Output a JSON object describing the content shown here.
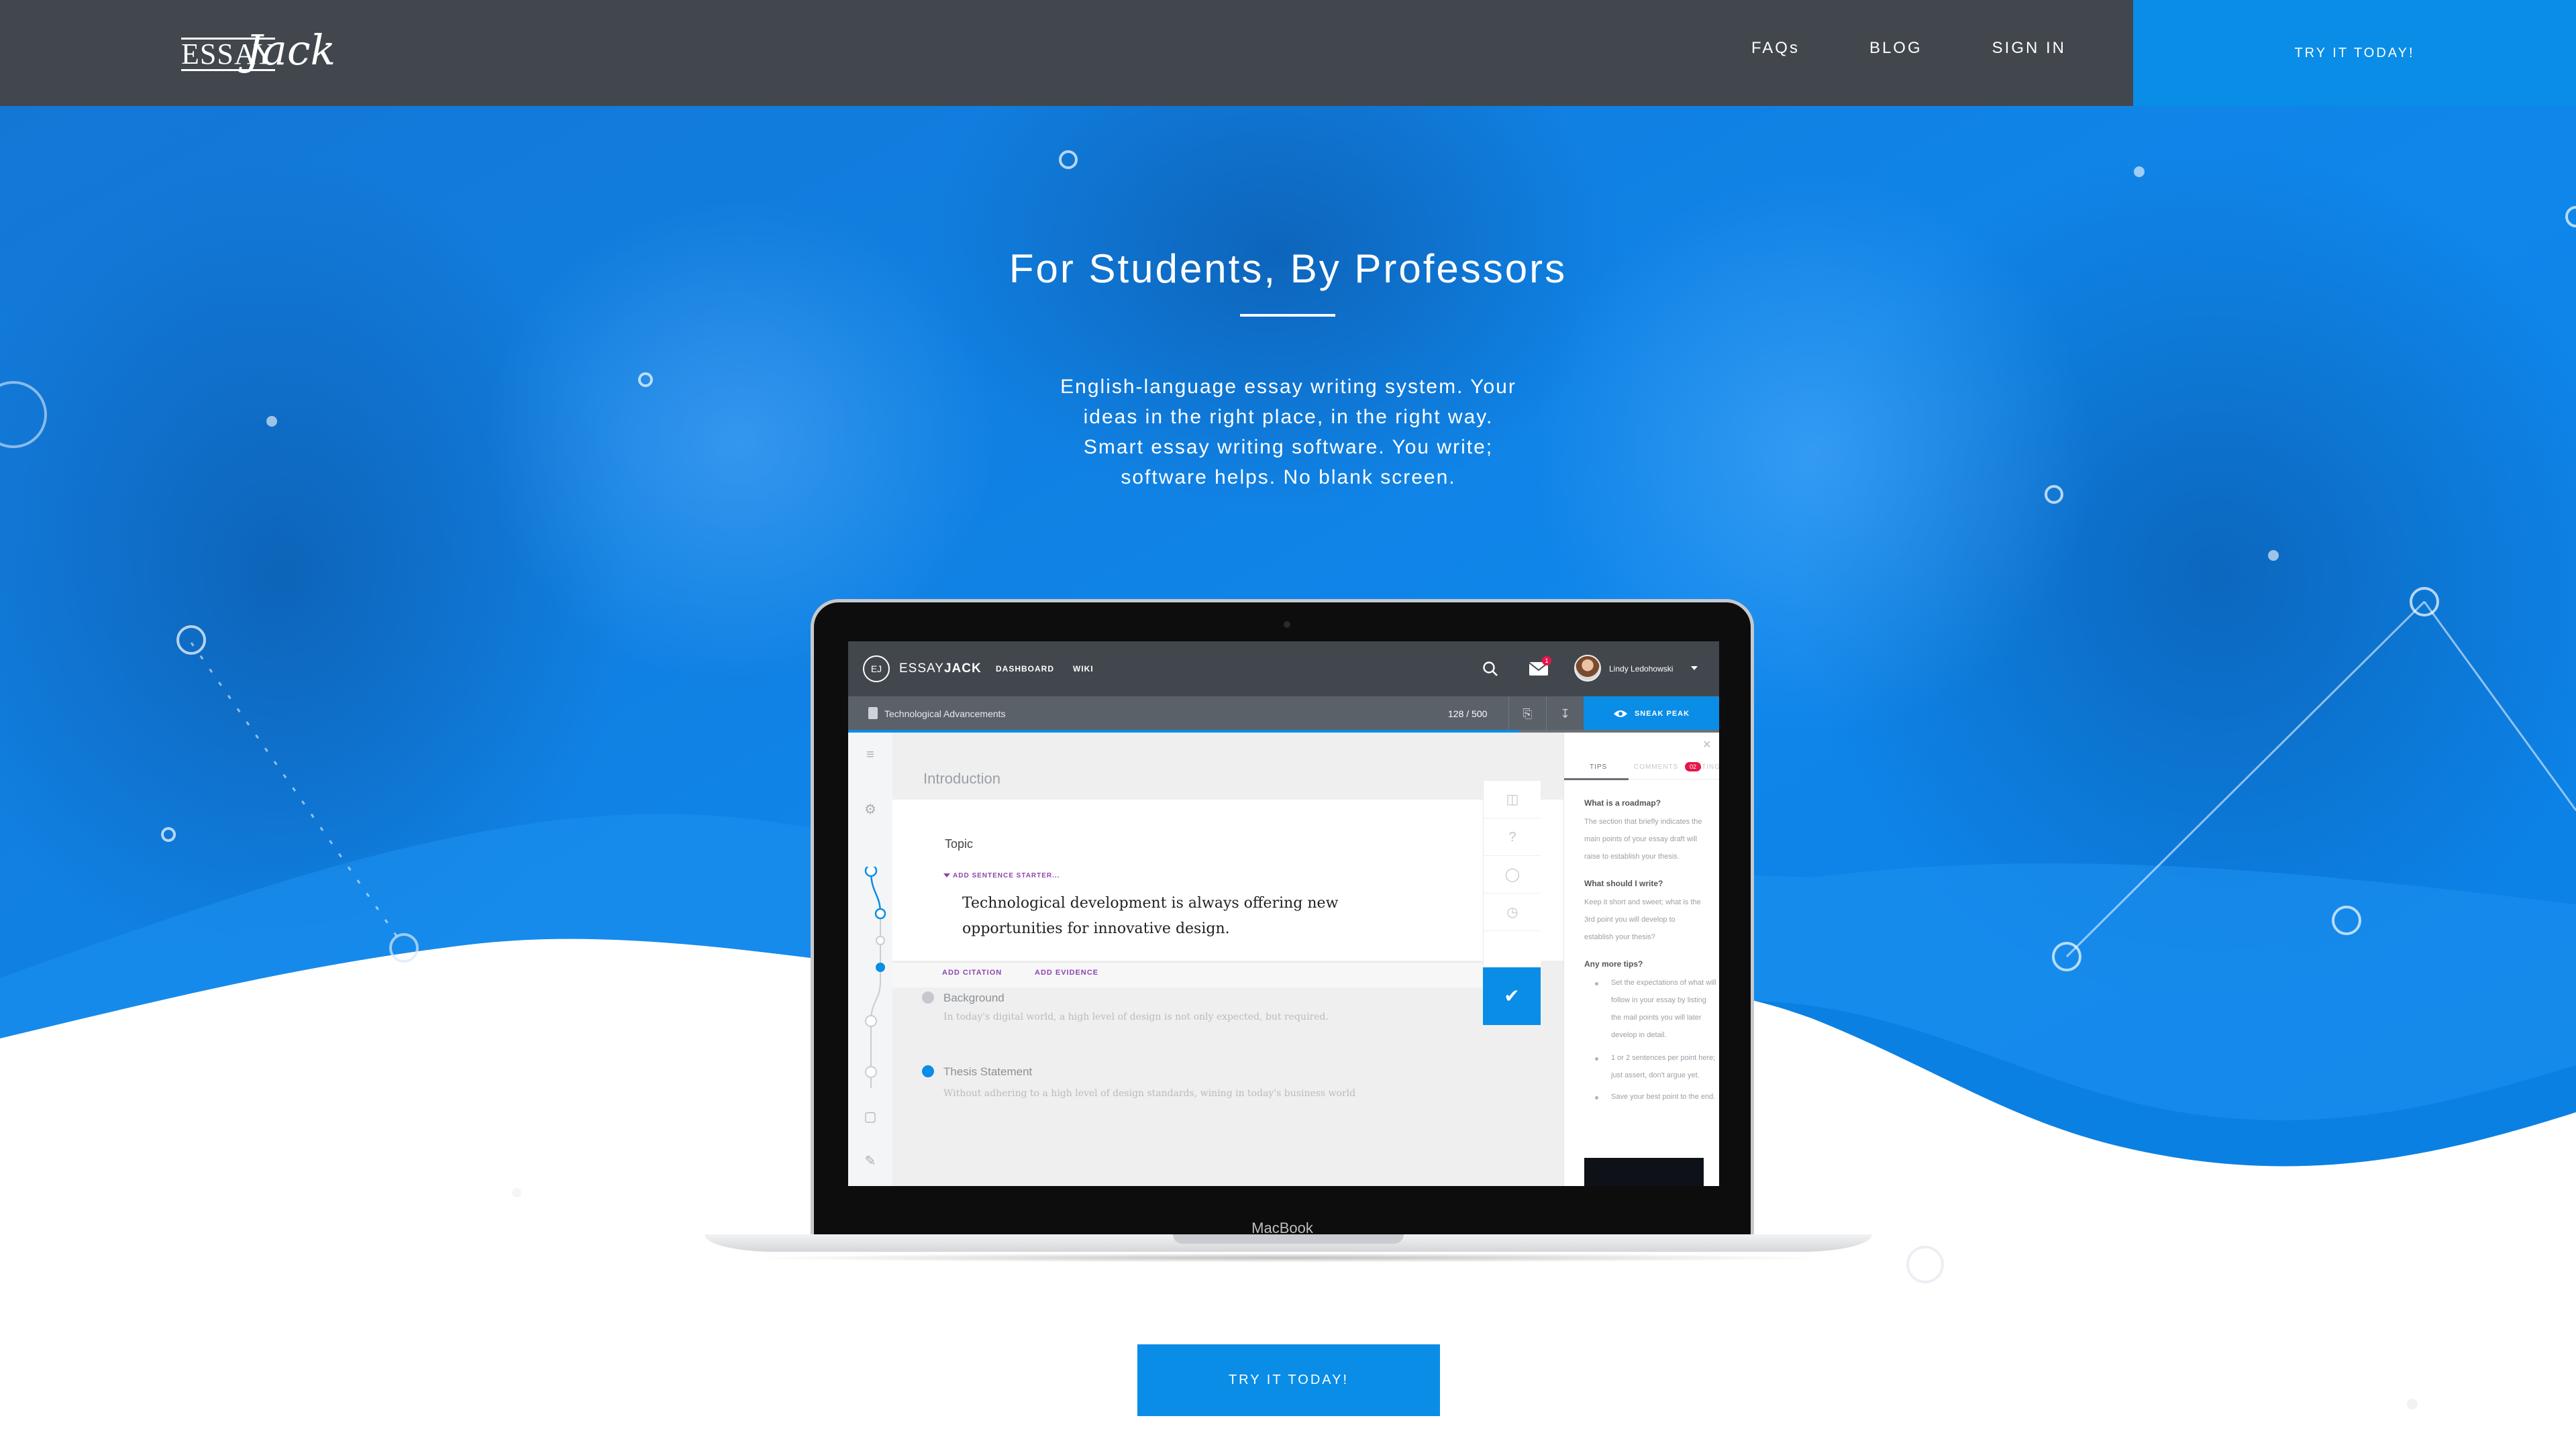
{
  "nav": {
    "logo_top": "ESSAY",
    "logo_script": "Jack",
    "links": [
      "FAQs",
      "BLOG",
      "SIGN IN"
    ],
    "cta_label": "TRY IT TODAY!"
  },
  "hero": {
    "title": "For Students, By Professors",
    "description_lines": [
      "English-language essay writing system. Your",
      "ideas in the right place, in the right way.",
      "Smart essay writing software. You write;",
      "software helps. No blank screen."
    ]
  },
  "laptop": {
    "label": "MacBook",
    "app": {
      "logo_mark": "EJ",
      "brand_light": "ESSAY",
      "brand_bold": "JACK",
      "nav": [
        "DASHBOARD",
        "WIKI"
      ],
      "mail_count": "1",
      "user_name": "Lindy Ledohowski",
      "doc_title": "Technological Advancements",
      "word_count": "128 / 500",
      "sneak_peak_label": "SNEAK PEAK",
      "section_heading": "Introduction",
      "topic_label": "Topic",
      "sentence_starter_label": "ADD SENTENCE STARTER...",
      "topic_sentence": "Technological development is always offering new opportunities for innovative design.",
      "add_citation_label": "ADD CITATION",
      "add_evidence_label": "ADD EVIDENCE",
      "sections": [
        {
          "title": "Background",
          "text": "In today's digital world, a high level of design is not only expected, but required."
        },
        {
          "title": "Thesis Statement",
          "text": "Without adhering to a high level of design standards, wining in today's business world"
        }
      ],
      "panel": {
        "tabs": [
          "TIPS",
          "COMMENTS",
          "RATINGS"
        ],
        "comments_badge": "02",
        "q1": "What is a roadmap?",
        "a1": "The section that briefly indicates the main points of your essay draft will raise to establish your thesis.",
        "q2": "What should I write?",
        "a2": "Keep it short and sweet; what is the 3rd point you will develop to establish your thesis?",
        "q3": "Any more tips?",
        "tips": [
          "Set the expectations of what will follow in your essay by listing the mail points you will later develop in detail.",
          "1 or 2 sentences per point here; just assert, don't argue yet.",
          "Save your best point to the end."
        ]
      }
    }
  },
  "cta": {
    "label": "TRY IT TODAY!"
  },
  "colors": {
    "nav_bg": "#41474d",
    "accent": "#0a8de6",
    "hero_blue": "#0d7fe0",
    "purple": "#8e44ad",
    "badge_red": "#e5164b"
  }
}
